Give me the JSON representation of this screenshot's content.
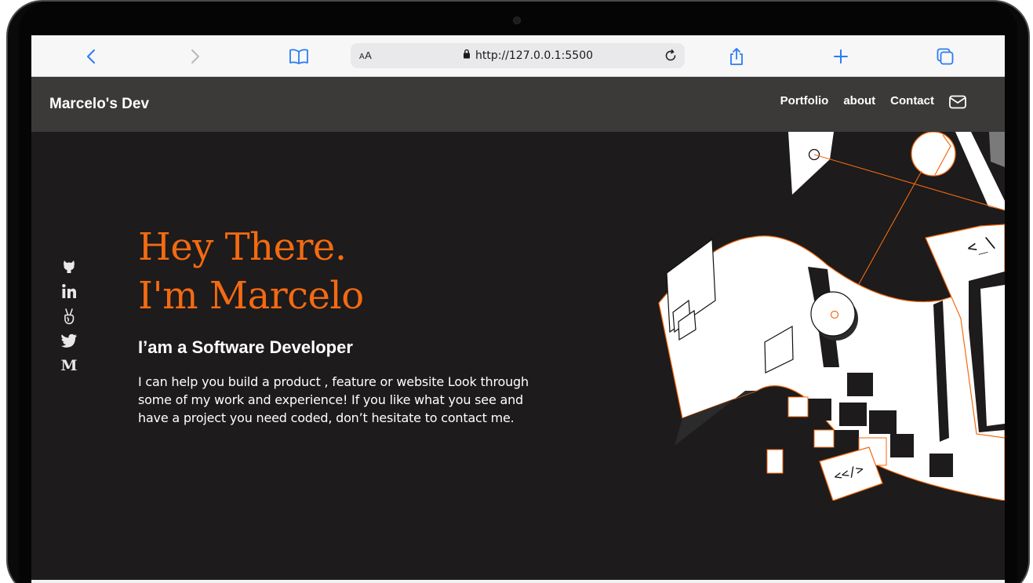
{
  "browser": {
    "url": "http://127.0.0.1:5500",
    "text_size_label": "AA",
    "icons": [
      "back-icon",
      "forward-icon",
      "bookmarks-icon",
      "lock-icon",
      "reload-icon",
      "share-icon",
      "new-tab-icon",
      "tabs-icon"
    ]
  },
  "nav": {
    "brand": "Marcelo's Dev",
    "links": [
      {
        "label": "Portfolio"
      },
      {
        "label": "about"
      },
      {
        "label": "Contact"
      }
    ],
    "mail_icon": "mail-icon"
  },
  "hero": {
    "headline_line1": "Hey There.",
    "headline_line2": "I'm Marcelo",
    "subtitle": "I’am a Software Developer",
    "description": "I can help you build a product , feature or website Look through some of my work and experience! If you like what you see and have a project you need coded, don’t hesitate to contact me.",
    "socials": [
      {
        "icon": "github-icon"
      },
      {
        "icon": "linkedin-icon"
      },
      {
        "icon": "angellist-icon"
      },
      {
        "icon": "twitter-icon"
      },
      {
        "icon": "medium-icon",
        "glyph": "M"
      }
    ],
    "illustration_labels": [
      "<_\\",
      "<</>"
    ]
  },
  "colors": {
    "accent": "#f36a12",
    "background": "#1d1b1b",
    "navbar": "#3b3a39",
    "text": "#ffffff"
  }
}
